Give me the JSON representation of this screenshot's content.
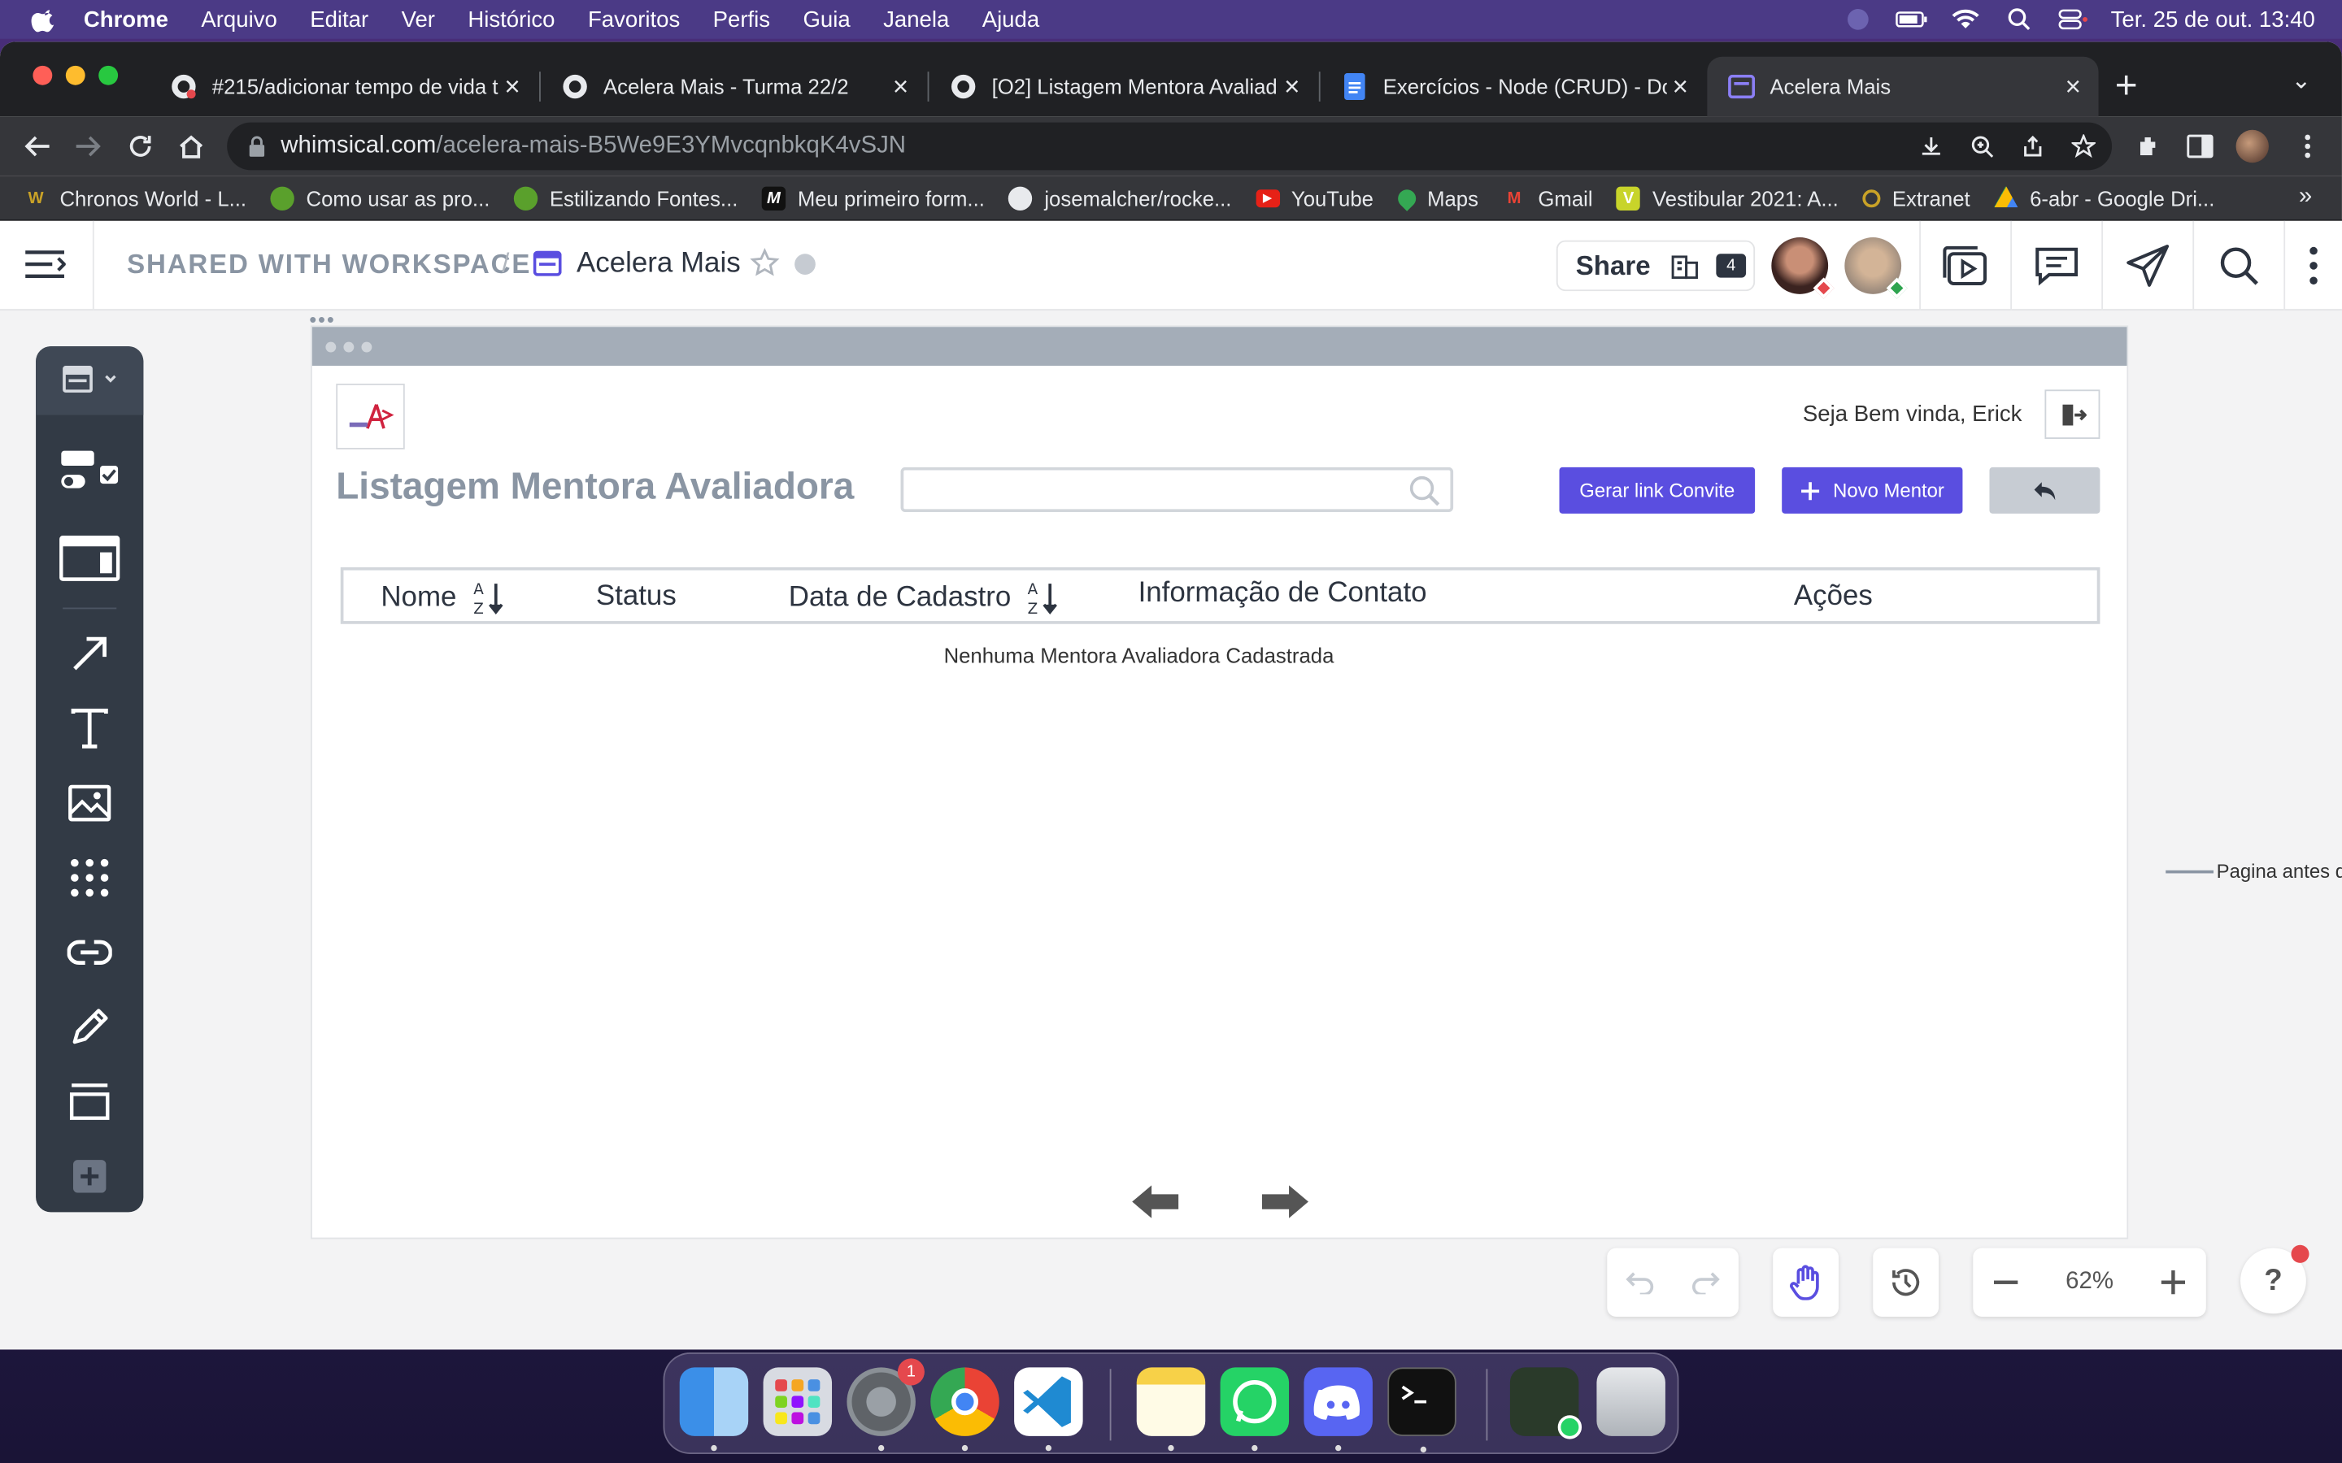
{
  "menubar": {
    "app": "Chrome",
    "items": [
      "Arquivo",
      "Editar",
      "Ver",
      "Histórico",
      "Favoritos",
      "Perfis",
      "Guia",
      "Janela",
      "Ajuda"
    ],
    "clock": "Ter. 25 de out.  13:40"
  },
  "tabs": [
    {
      "title": "#215/adicionar tempo de vida t",
      "icon": "github-icon"
    },
    {
      "title": "Acelera Mais - Turma 22/2",
      "icon": "github-icon"
    },
    {
      "title": "[O2] Listagem Mentora Avaliad",
      "icon": "github-icon"
    },
    {
      "title": "Exercícios - Node (CRUD) - Do",
      "icon": "google-docs-icon"
    },
    {
      "title": "Acelera Mais",
      "icon": "whimsical-icon"
    }
  ],
  "address": {
    "domain": "whimsical.com",
    "path": "/acelera-mais-B5We9E3YMvcqnbkqK4vSJN"
  },
  "bookmarks": [
    {
      "label": "Chronos World - L...",
      "color": "#c9a227",
      "glyph": "W"
    },
    {
      "label": "Como usar as pro...",
      "color": "#5aa02c",
      "glyph": ""
    },
    {
      "label": "Estilizando Fontes...",
      "color": "#5aa02c",
      "glyph": ""
    },
    {
      "label": "Meu primeiro form...",
      "color": "#111111",
      "glyph": "M"
    },
    {
      "label": "josemalcher/rocke...",
      "color": "#e8eaed",
      "glyph": ""
    },
    {
      "label": "YouTube",
      "color": "#e62117",
      "glyph": "▶"
    },
    {
      "label": "Maps",
      "color": "#34a853",
      "glyph": ""
    },
    {
      "label": "Gmail",
      "color": "#ea4335",
      "glyph": "M"
    },
    {
      "label": "Vestibular 2021: A...",
      "color": "#c8d42a",
      "glyph": "V"
    },
    {
      "label": "Extranet",
      "color": "#c9a227",
      "glyph": ""
    },
    {
      "label": "6-abr - Google Dri...",
      "color": "#fbbc04",
      "glyph": ""
    }
  ],
  "whimsical": {
    "breadcrumb": "SHARED WITH WORKSPACE",
    "separator": "/",
    "board_name": "Acelera Mais",
    "share_label": "Share",
    "member_count": "4",
    "zoom": "62%",
    "help": "?"
  },
  "wireframe": {
    "welcome": "Seja Bem vinda, Erick",
    "title": "Listagem Mentora Avaliadora",
    "search_placeholder": "",
    "btn_invite": "Gerar link Convite",
    "btn_new": "Novo Mentor",
    "columns": [
      "Nome",
      "Status",
      "Data de Cadastro",
      "Informação de Contato",
      "Ações"
    ],
    "empty_message": "Nenhuma Mentora Avaliadora Cadastrada",
    "side_note": "Pagina antes d"
  },
  "colors": {
    "accent": "#5a4ee0",
    "toolbar_dark": "#323a45"
  }
}
